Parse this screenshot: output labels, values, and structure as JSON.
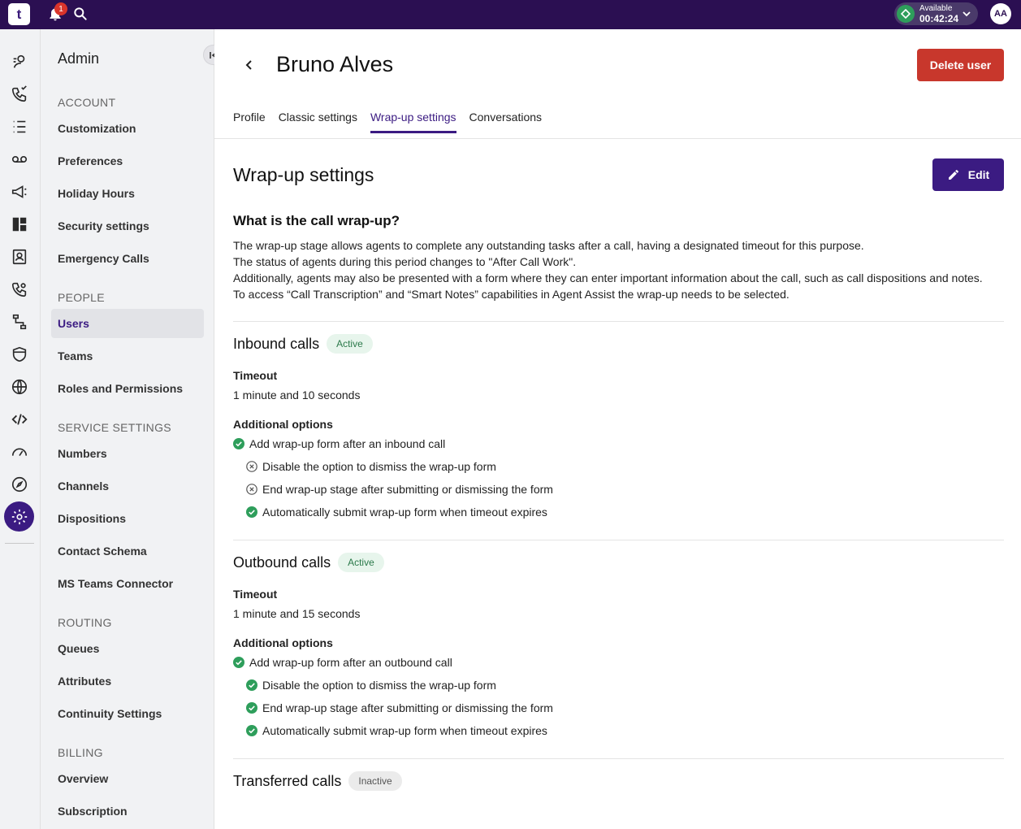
{
  "topbar": {
    "logo": "t",
    "notification_count": "1",
    "status_label": "Available",
    "status_timer": "00:42:24",
    "avatar_initials": "AA"
  },
  "sidebar": {
    "title": "Admin",
    "sections": [
      {
        "label": "ACCOUNT",
        "items": [
          "Customization",
          "Preferences",
          "Holiday Hours",
          "Security settings",
          "Emergency Calls"
        ]
      },
      {
        "label": "PEOPLE",
        "items": [
          "Users",
          "Teams",
          "Roles and Permissions"
        ]
      },
      {
        "label": "SERVICE SETTINGS",
        "items": [
          "Numbers",
          "Channels",
          "Dispositions",
          "Contact Schema",
          "MS Teams Connector"
        ]
      },
      {
        "label": "ROUTING",
        "items": [
          "Queues",
          "Attributes",
          "Continuity Settings"
        ]
      },
      {
        "label": "BILLING",
        "items": [
          "Overview",
          "Subscription"
        ]
      }
    ],
    "active_item": "Users"
  },
  "header": {
    "title": "Bruno Alves",
    "delete_label": "Delete user",
    "tabs": [
      "Profile",
      "Classic settings",
      "Wrap-up settings",
      "Conversations"
    ],
    "active_tab": "Wrap-up settings"
  },
  "content": {
    "title": "Wrap-up settings",
    "edit_label": "Edit",
    "what_title": "What is the call wrap-up?",
    "description": [
      "The wrap-up stage allows agents to complete any outstanding tasks after a call, having a designated timeout for this purpose.",
      "The status of agents during this period changes to \"After Call Work\".",
      "Additionally, agents may also be presented with a form where they can enter important information about the call, such as call dispositions and notes.",
      "To access “Call Transcription” and “Smart Notes” capabilities in Agent Assist the wrap-up needs to be selected."
    ],
    "timeout_label": "Timeout",
    "options_label": "Additional options",
    "inbound": {
      "title": "Inbound calls",
      "badge": "Active",
      "timeout": "1 minute and 10 seconds",
      "main_option": "Add wrap-up form after an inbound call",
      "sub_options": [
        {
          "label": "Disable the option to dismiss the wrap-up form",
          "enabled": false
        },
        {
          "label": "End wrap-up stage after submitting or dismissing the form",
          "enabled": false
        },
        {
          "label": "Automatically submit wrap-up form when timeout expires",
          "enabled": true
        }
      ]
    },
    "outbound": {
      "title": "Outbound calls",
      "badge": "Active",
      "timeout": "1 minute and 15 seconds",
      "main_option": "Add wrap-up form after an outbound call",
      "sub_options": [
        {
          "label": "Disable the option to dismiss the wrap-up form",
          "enabled": true
        },
        {
          "label": "End wrap-up stage after submitting or dismissing the form",
          "enabled": true
        },
        {
          "label": "Automatically submit wrap-up form when timeout expires",
          "enabled": true
        }
      ]
    },
    "transferred": {
      "title": "Transferred calls",
      "badge": "Inactive"
    }
  },
  "colors": {
    "topbar": "#2b0f52",
    "accent": "#3b1b82",
    "danger": "#c8372c",
    "success": "#2e9e5b"
  }
}
